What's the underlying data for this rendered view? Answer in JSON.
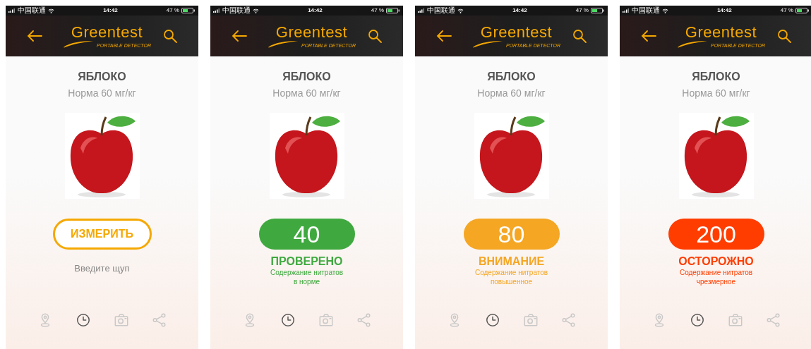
{
  "screens": [
    {
      "status_bar": {
        "carrier": "中国联通",
        "time": "14:42",
        "battery": "47 %"
      },
      "header": {
        "logo": "Greentest",
        "tagline": "PORTABLE DETECTOR"
      },
      "product": {
        "name": "ЯБЛОКО",
        "norm": "Норма 60 мг/кг"
      },
      "result": {
        "kind": "button",
        "label": "ИЗМЕРИТЬ",
        "hint": "Введите щуп",
        "color": "#f5a800"
      },
      "tabbar": [
        {
          "kind": "map",
          "selected": false
        },
        {
          "kind": "history",
          "selected": true
        },
        {
          "kind": "camera",
          "selected": false
        },
        {
          "kind": "share",
          "selected": false
        }
      ]
    },
    {
      "status_bar": {
        "carrier": "中国联通",
        "time": "14:42",
        "battery": "47 %"
      },
      "header": {
        "logo": "Greentest",
        "tagline": "PORTABLE DETECTOR"
      },
      "product": {
        "name": "ЯБЛОКО",
        "norm": "Норма 60 мг/кг"
      },
      "result": {
        "kind": "reading",
        "value": "40",
        "status": "ПРОВЕРЕНО",
        "message": "Содержание нитратов\nв норме",
        "color": "#3fa93f"
      },
      "tabbar": [
        {
          "kind": "map",
          "selected": false
        },
        {
          "kind": "history",
          "selected": true
        },
        {
          "kind": "camera",
          "selected": false
        },
        {
          "kind": "share",
          "selected": false
        }
      ]
    },
    {
      "status_bar": {
        "carrier": "中国联通",
        "time": "14:42",
        "battery": "47 %"
      },
      "header": {
        "logo": "Greentest",
        "tagline": "PORTABLE DETECTOR"
      },
      "product": {
        "name": "ЯБЛОКО",
        "norm": "Норма 60 мг/кг"
      },
      "result": {
        "kind": "reading",
        "value": "80",
        "status": "ВНИМАНИЕ",
        "message": "Содержание нитратов\nповышенное",
        "color": "#f5a623"
      },
      "tabbar": [
        {
          "kind": "map",
          "selected": false
        },
        {
          "kind": "history",
          "selected": true
        },
        {
          "kind": "camera",
          "selected": false
        },
        {
          "kind": "share",
          "selected": false
        }
      ]
    },
    {
      "status_bar": {
        "carrier": "中国联通",
        "time": "14:42",
        "battery": "47 %"
      },
      "header": {
        "logo": "Greentest",
        "tagline": "PORTABLE DETECTOR"
      },
      "product": {
        "name": "ЯБЛОКО",
        "norm": "Норма 60 мг/кг"
      },
      "result": {
        "kind": "reading",
        "value": "200",
        "status": "ОСТОРОЖНО",
        "message": "Содержание нитратов\nчрезмерное",
        "color": "#ff3d00"
      },
      "tabbar": [
        {
          "kind": "map",
          "selected": false
        },
        {
          "kind": "history",
          "selected": true
        },
        {
          "kind": "camera",
          "selected": false
        },
        {
          "kind": "share",
          "selected": false
        }
      ]
    }
  ]
}
